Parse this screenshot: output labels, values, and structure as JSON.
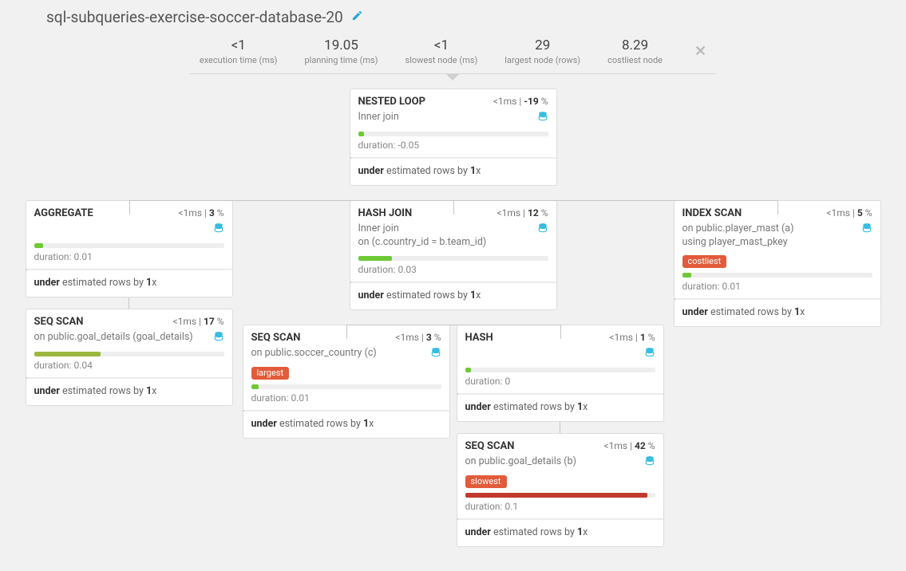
{
  "title": "sql-subqueries-exercise-soccer-database-20",
  "stats": {
    "exec_time": {
      "value": "<1",
      "label": "execution time (ms)"
    },
    "planning_time": {
      "value": "19.05",
      "label": "planning time (ms)"
    },
    "slowest_node": {
      "value": "<1",
      "label": "slowest node (ms)"
    },
    "largest_node": {
      "value": "29",
      "label": "largest node (rows)"
    },
    "costliest_node": {
      "value": "8.29",
      "label": "costliest node"
    }
  },
  "nodes": {
    "nested_loop": {
      "title": "NESTED LOOP",
      "time": "<1",
      "time_unit": "ms",
      "pct": "-19",
      "sub": "Inner join",
      "duration": "-0.05",
      "bar": {
        "width": 3,
        "class": "bar-green"
      },
      "est": {
        "dir": "under",
        "by": "1"
      }
    },
    "aggregate": {
      "title": "AGGREGATE",
      "time": "<1",
      "time_unit": "ms",
      "pct": "3",
      "sub": "",
      "duration": "0.01",
      "bar": {
        "width": 5,
        "class": "bar-green"
      },
      "est": {
        "dir": "under",
        "by": "1"
      }
    },
    "seq_goal": {
      "title": "SEQ SCAN",
      "time": "<1",
      "time_unit": "ms",
      "pct": "17",
      "sub": "on public.goal_details (goal_details)",
      "duration": "0.04",
      "bar": {
        "width": 35,
        "class": "bar-olive"
      },
      "est": {
        "dir": "under",
        "by": "1"
      }
    },
    "hash_join": {
      "title": "HASH JOIN",
      "time": "<1",
      "time_unit": "ms",
      "pct": "12",
      "sub_line1": "Inner join",
      "sub_line2": "on (c.country_id = b.team_id)",
      "duration": "0.03",
      "bar": {
        "width": 18,
        "class": "bar-green"
      },
      "est": {
        "dir": "under",
        "by": "1"
      }
    },
    "seq_country": {
      "title": "SEQ SCAN",
      "time": "<1",
      "time_unit": "ms",
      "pct": "3",
      "sub": "on public.soccer_country (c)",
      "badge": "largest",
      "duration": "0.01",
      "bar": {
        "width": 4,
        "class": "bar-green"
      },
      "est": {
        "dir": "under",
        "by": "1"
      }
    },
    "hash": {
      "title": "HASH",
      "time": "<1",
      "time_unit": "ms",
      "pct": "1",
      "sub": "",
      "duration": "0",
      "bar": {
        "width": 3,
        "class": "bar-green"
      },
      "est": {
        "dir": "under",
        "by": "1"
      }
    },
    "seq_goal_b": {
      "title": "SEQ SCAN",
      "time": "<1",
      "time_unit": "ms",
      "pct": "42",
      "sub": "on public.goal_details (b)",
      "badge": "slowest",
      "duration": "0.1",
      "bar": {
        "width": 96,
        "class": "bar-red"
      },
      "est": {
        "dir": "under",
        "by": "1"
      }
    },
    "index_scan": {
      "title": "INDEX SCAN",
      "time": "<1",
      "time_unit": "ms",
      "pct": "5",
      "sub_line1": "on public.player_mast (a)",
      "sub_line2": "using player_mast_pkey",
      "badge": "costliest",
      "duration": "0.01",
      "bar": {
        "width": 5,
        "class": "bar-green"
      },
      "est": {
        "dir": "under",
        "by": "1"
      }
    }
  },
  "labels": {
    "duration_prefix": "duration: ",
    "est_mid": " estimated rows by ",
    "est_suffix": "x",
    "sep": " | ",
    "pct": " %"
  }
}
